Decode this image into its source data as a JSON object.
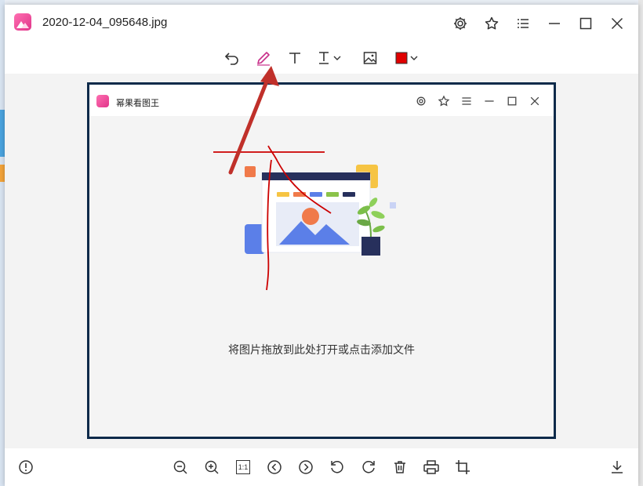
{
  "window": {
    "title": "2020-12-04_095648.jpg",
    "controls": [
      "gear-icon",
      "star-icon",
      "menu-icon",
      "minimize-icon",
      "maximize-icon",
      "close-icon"
    ]
  },
  "toolbar": {
    "tools": [
      "undo-icon",
      "pen-icon",
      "text-icon",
      "text-style-icon",
      "image-icon",
      "color-picker"
    ],
    "active_tool": "pen-icon",
    "current_color": "#e00000"
  },
  "image_content": {
    "app_title": "幂果看图王",
    "hint": "将图片拖放到此处打开或点击添加文件"
  },
  "bottombar": {
    "tools": [
      "info-icon",
      "zoom-out-icon",
      "zoom-in-icon",
      "actual-size-icon",
      "prev-icon",
      "next-icon",
      "rotate-left-icon",
      "rotate-right-icon",
      "delete-icon",
      "print-icon",
      "crop-icon",
      "download-icon"
    ],
    "actual_size_label": "1:1"
  },
  "colors": {
    "accent": "#e0358a",
    "annotation": "#d00000",
    "arrow": "#c0302a"
  }
}
